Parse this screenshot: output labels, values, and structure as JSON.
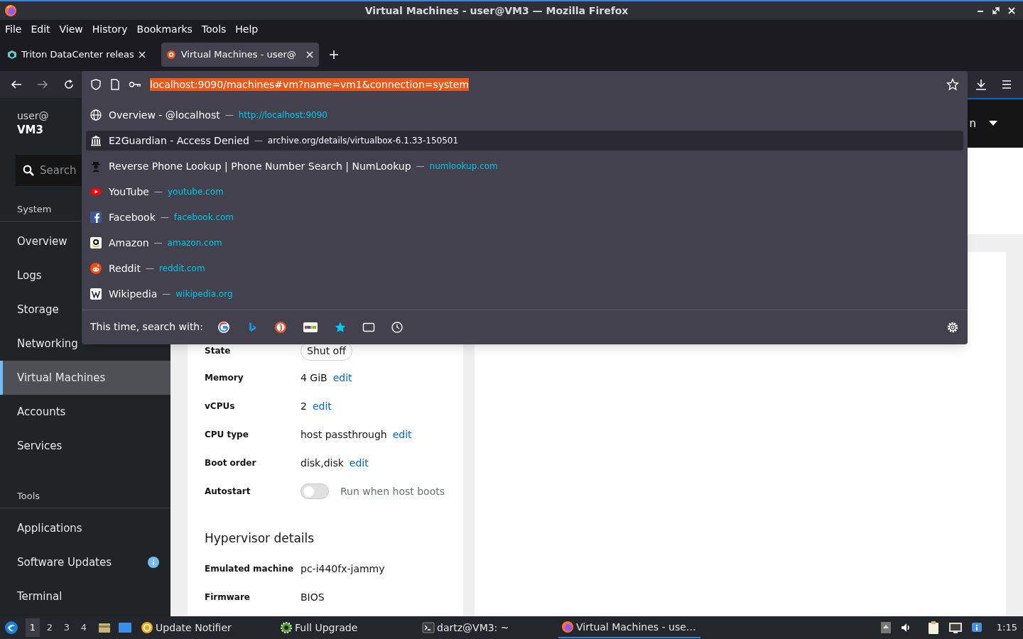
{
  "window": {
    "title": "Virtual Machines - user@VM3 — Mozilla Firefox"
  },
  "menu": [
    "File",
    "Edit",
    "View",
    "History",
    "Bookmarks",
    "Tools",
    "Help"
  ],
  "tabs": [
    {
      "title": "Triton DataCenter releas",
      "selected": false
    },
    {
      "title": "Virtual Machines - user@",
      "selected": true
    }
  ],
  "address_bar": {
    "url": "localhost:9090/machines#vm?name=vm1&connection=system"
  },
  "suggestions": [
    {
      "title": "Overview - @localhost",
      "separator": "—",
      "url": "http://localhost:9090",
      "selected": false
    },
    {
      "title": "E2Guardian - Access Denied",
      "separator": "—",
      "url": "archive.org/details/virtualbox-6.1.33-150501",
      "selected": true
    },
    {
      "title": "Reverse Phone Lookup | Phone Number Search | NumLookup",
      "separator": "—",
      "url": "numlookup.com",
      "selected": false
    },
    {
      "title": "YouTube",
      "separator": "—",
      "url": "youtube.com",
      "selected": false
    },
    {
      "title": "Facebook",
      "separator": "—",
      "url": "facebook.com",
      "selected": false
    },
    {
      "title": "Amazon",
      "separator": "—",
      "url": "amazon.com",
      "selected": false
    },
    {
      "title": "Reddit",
      "separator": "—",
      "url": "reddit.com",
      "selected": false
    },
    {
      "title": "Wikipedia",
      "separator": "—",
      "url": "wikipedia.org",
      "selected": false
    }
  ],
  "search_with": {
    "label": "This time, search with:"
  },
  "sidebar": {
    "user": "user@",
    "host": "VM3",
    "search_placeholder": "Search",
    "sections": [
      {
        "label": "System",
        "items": [
          {
            "label": "Overview",
            "selected": false,
            "notice": false
          },
          {
            "label": "Logs",
            "selected": false,
            "notice": false
          },
          {
            "label": "Storage",
            "selected": false,
            "notice": false
          },
          {
            "label": "Networking",
            "selected": false,
            "notice": false
          },
          {
            "label": "Virtual Machines",
            "selected": true,
            "notice": false
          },
          {
            "label": "Accounts",
            "selected": false,
            "notice": false
          },
          {
            "label": "Services",
            "selected": false,
            "notice": false
          }
        ]
      },
      {
        "label": "Tools",
        "items": [
          {
            "label": "Applications",
            "selected": false,
            "notice": false
          },
          {
            "label": "Software Updates",
            "selected": false,
            "notice": true
          },
          {
            "label": "Terminal",
            "selected": false,
            "notice": false
          }
        ]
      }
    ]
  },
  "header": {
    "text": "n"
  },
  "details": {
    "rows": [
      {
        "kind": "badge",
        "label": "State",
        "value": "Shut off"
      },
      {
        "kind": "editable",
        "label": "Memory",
        "value": "4 GiB",
        "link": "edit"
      },
      {
        "kind": "editable",
        "label": "vCPUs",
        "value": "2",
        "link": "edit"
      },
      {
        "kind": "editable",
        "label": "CPU type",
        "value": "host passthrough",
        "link": "edit"
      },
      {
        "kind": "editable",
        "label": "Boot order",
        "value": "disk,disk",
        "link": "edit"
      },
      {
        "kind": "toggle",
        "label": "Autostart",
        "on": false,
        "value": "Run when host boots"
      }
    ]
  },
  "hypervisor": {
    "title": "Hypervisor details",
    "rows": [
      {
        "label": "Emulated machine",
        "value": "pc-i440fx-jammy"
      },
      {
        "label": "Firmware",
        "value": "BIOS"
      }
    ]
  },
  "taskbar": {
    "workspaces": [
      {
        "label": "1",
        "selected": true
      },
      {
        "label": "2",
        "selected": false
      },
      {
        "label": "3",
        "selected": false
      },
      {
        "label": "4",
        "selected": false
      }
    ],
    "tasks": [
      {
        "label": "Update Notifier",
        "active": false
      },
      {
        "label": "Full Upgrade",
        "active": false
      },
      {
        "label": "dartz@VM3: ~",
        "active": false
      },
      {
        "label": "Virtual Machines - use…",
        "active": true
      }
    ],
    "clock": "1:15"
  }
}
